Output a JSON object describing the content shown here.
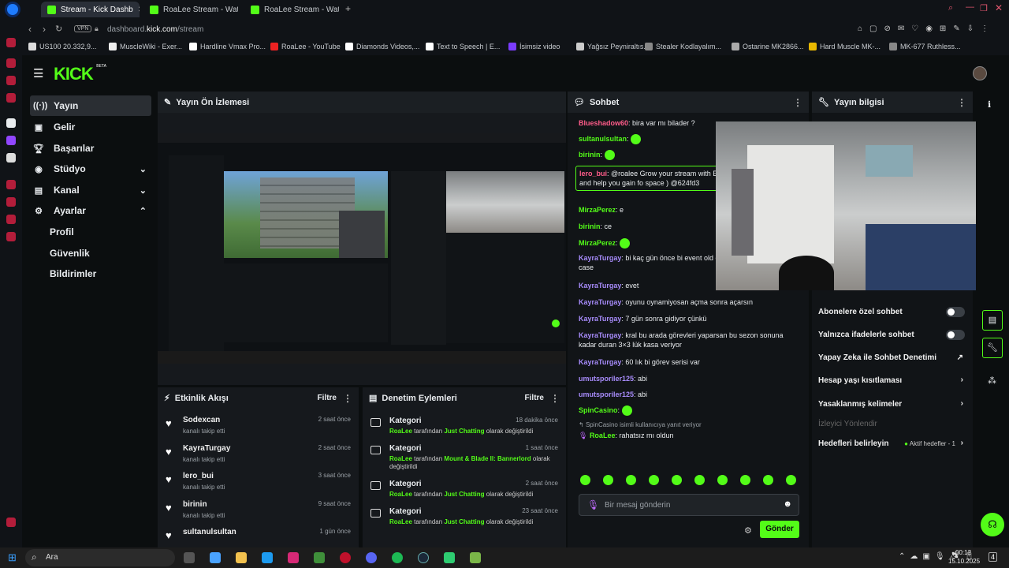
{
  "browser": {
    "tabs": [
      {
        "label": "Stream - Kick Dashb",
        "active": true
      },
      {
        "label": "RoaLee Stream - Watch L"
      },
      {
        "label": "RoaLee Stream - Watch L"
      }
    ],
    "address": {
      "vpn": "VPN",
      "prefix": "dashboard.",
      "domain": "kick.com",
      "path": "/stream"
    },
    "bookmarks": [
      "US100 20.332,9...",
      "MuscleWiki - Exer...",
      "Hardline Vmax Pro...",
      "RoaLee - YouTube",
      "Diamonds Videos,...",
      "Text to Speech | E...",
      "İsimsiz video",
      "Yağsız Peyniraltıs...",
      "Stealer Kodlayalım...",
      "Ostarine MK2866...",
      "Hard Muscle MK-...",
      "MK-677 Ruthless..."
    ]
  },
  "brand": {
    "logo": "KICK",
    "beta": "BETA",
    "accent": "#53fc18"
  },
  "sidebar": {
    "items": [
      {
        "label": "Yayın",
        "icon": "broadcast-icon"
      },
      {
        "label": "Gelir",
        "icon": "money-icon"
      },
      {
        "label": "Başarılar",
        "icon": "trophy-icon"
      },
      {
        "label": "Stüdyo",
        "icon": "camera-icon"
      },
      {
        "label": "Kanal",
        "icon": "channel-icon"
      },
      {
        "label": "Ayarlar",
        "icon": "gear-icon"
      }
    ],
    "sub_items": [
      "Profil",
      "Güvenlik",
      "Bildirimler"
    ]
  },
  "preview": {
    "title": "Yayın Ön İzlemesi"
  },
  "events": {
    "title": "Etkinlik Akışı",
    "filter": "Filtre",
    "rows": [
      {
        "name": "Sodexcan",
        "desc": "kanalı takip etti",
        "time": "2 saat önce"
      },
      {
        "name": "KayraTurgay",
        "desc": "kanalı takip etti",
        "time": "2 saat önce"
      },
      {
        "name": "lero_bui",
        "desc": "kanalı takip etti",
        "time": "3 saat önce"
      },
      {
        "name": "birinin",
        "desc": "kanalı takip etti",
        "time": "9 saat önce"
      },
      {
        "name": "sultanulsultan",
        "desc": "",
        "time": "1 gün önce"
      }
    ]
  },
  "moderation": {
    "title": "Denetim Eylemleri",
    "filter": "Filtre",
    "rows": [
      {
        "title": "Kategori",
        "user": "RoaLee",
        "mid": "tarafından",
        "cat": "Just Chatting",
        "end": "olarak değiştirildi",
        "time": "18 dakika önce"
      },
      {
        "title": "Kategori",
        "user": "RoaLee",
        "mid": "tarafından",
        "cat": "Mount & Blade II: Bannerlord",
        "end": "olarak değiştirildi",
        "time": "1 saat önce"
      },
      {
        "title": "Kategori",
        "user": "RoaLee",
        "mid": "tarafından",
        "cat": "Just Chatting",
        "end": "olarak değiştirildi",
        "time": "2 saat önce"
      },
      {
        "title": "Kategori",
        "user": "RoaLee",
        "mid": "tarafından",
        "cat": "Just Chatting",
        "end": "olarak değiştirildi",
        "time": "23 saat önce"
      }
    ]
  },
  "chat": {
    "title": "Sohbet",
    "messages": [
      {
        "user": "Blueshadow60",
        "color": "#ff5c8a",
        "text": "bira var mı bilader ?"
      },
      {
        "user": "sultanulsultan",
        "color": "#53fc18",
        "text": ""
      },
      {
        "user": "birinin",
        "color": "#53fc18",
        "text": ""
      },
      {
        "user": "lero_bui",
        "color": "#ff5c8a",
        "text": "@roalee Grow your stream with E keep your chat active and help you gain fo space ) @624fd3"
      },
      {
        "user": "MirzaPerez",
        "color": "#53fc18",
        "text": "e"
      },
      {
        "user": "birinin",
        "color": "#53fc18",
        "text": "ce"
      },
      {
        "user": "MirzaPerez",
        "color": "#53fc18",
        "text": ""
      },
      {
        "user": "KayraTurgay",
        "color": "#a78bfa",
        "text": "bi kaç gün önce bi event old girdiysen 7 günlük verdi case"
      },
      {
        "user": "KayraTurgay",
        "color": "#a78bfa",
        "text": "evet"
      },
      {
        "user": "KayraTurgay",
        "color": "#a78bfa",
        "text": "oyunu oynamiyosan açma sonra açarsın"
      },
      {
        "user": "KayraTurgay",
        "color": "#a78bfa",
        "text": "7 gün sonra gidiyor çünkü"
      },
      {
        "user": "KayraTurgay",
        "color": "#a78bfa",
        "text": "kral bu arada görevleri yaparsan bu sezon sonuna kadar duran 3×3 lük kasa veriyor"
      },
      {
        "user": "KayraTurgay",
        "color": "#a78bfa",
        "text": "60 lık bi görev serisi var"
      },
      {
        "user": "umutsporiler125",
        "color": "#a78bfa",
        "text": "abi"
      },
      {
        "user": "umutsporiler125",
        "color": "#a78bfa",
        "text": "abi"
      },
      {
        "user": "SpinCasino",
        "color": "#53fc18",
        "text": ""
      }
    ],
    "reply_note": {
      "user": "SpinCasino",
      "text": "isimli kullanıcıya yanıt veriyor"
    },
    "last": {
      "user": "RoaLee",
      "text": "rahatsız mı oldun"
    },
    "placeholder": "Bir mesaj gönderin",
    "send": "Gönder"
  },
  "info": {
    "title": "Yayın bilgisi",
    "rows": [
      {
        "label": "Abonelere özel sohbet",
        "control": "toggle"
      },
      {
        "label": "Yalnızca ifadelerle sohbet",
        "control": "toggle"
      },
      {
        "label": "Yapay Zeka ile Sohbet Denetimi",
        "control": "external"
      },
      {
        "label": "Hesap yaşı kısıtlaması",
        "control": "chevron"
      },
      {
        "label": "Yasaklanmış kelimeler",
        "control": "chevron"
      }
    ],
    "viewer": "İzleyici Yönlendir",
    "goals": {
      "label": "Hedefleri belirleyin",
      "status": "Aktif hedefler - 1"
    }
  },
  "taskbar": {
    "search": "Ara",
    "time": "00:12",
    "date": "15.10.2025",
    "badge": "4"
  }
}
